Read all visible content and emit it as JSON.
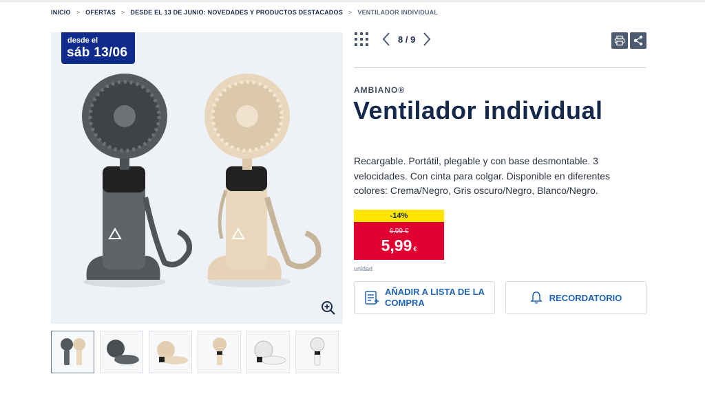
{
  "breadcrumb": {
    "items": [
      "INICIO",
      "OFERTAS",
      "DESDE EL 13 DE JUNIO: NOVEDADES Y PRODUCTOS DESTACADOS"
    ],
    "current": "VENTILADOR INDIVIDUAL",
    "separator": ">"
  },
  "badge": {
    "line1": "desde el",
    "line2": "sáb 13/06"
  },
  "gallery": {
    "counter": "8 / 9",
    "thumbnails": [
      "gris y crema",
      "gris oscuro",
      "crema",
      "crema",
      "blanco",
      "blanco"
    ],
    "active_index": 0
  },
  "product": {
    "brand": "AMBIANO®",
    "title": "Ventilador individual",
    "description": "Recargable. Portátil, plegable y con base desmontable. 3 velocidades. Con cinta para colgar. Disponible en diferentes colores: Crema/Negro, Gris oscuro/Negro, Blanco/Negro."
  },
  "price": {
    "discount": "-14%",
    "old": "6,99 €",
    "new": "5,99",
    "currency": "€",
    "unit": "unidad"
  },
  "buttons": {
    "add_to_list": "AÑADIR A LISTA DE LA COMPRA",
    "reminder": "RECORDATORIO"
  },
  "icons": {
    "grid": "grid-icon",
    "prev": "chevron-left-icon",
    "next": "chevron-right-icon",
    "print": "print-icon",
    "share": "share-icon",
    "zoom": "zoom-in-icon",
    "list": "shopping-list-icon",
    "bell": "bell-icon"
  },
  "colors": {
    "badge": "#0f2b8b",
    "discount": "#ffe500",
    "price": "#e10032",
    "accent": "#1f63b5",
    "fan_gray": "#5d6266",
    "fan_cream": "#e8d5bb",
    "fan_white": "#f1f1f1"
  }
}
